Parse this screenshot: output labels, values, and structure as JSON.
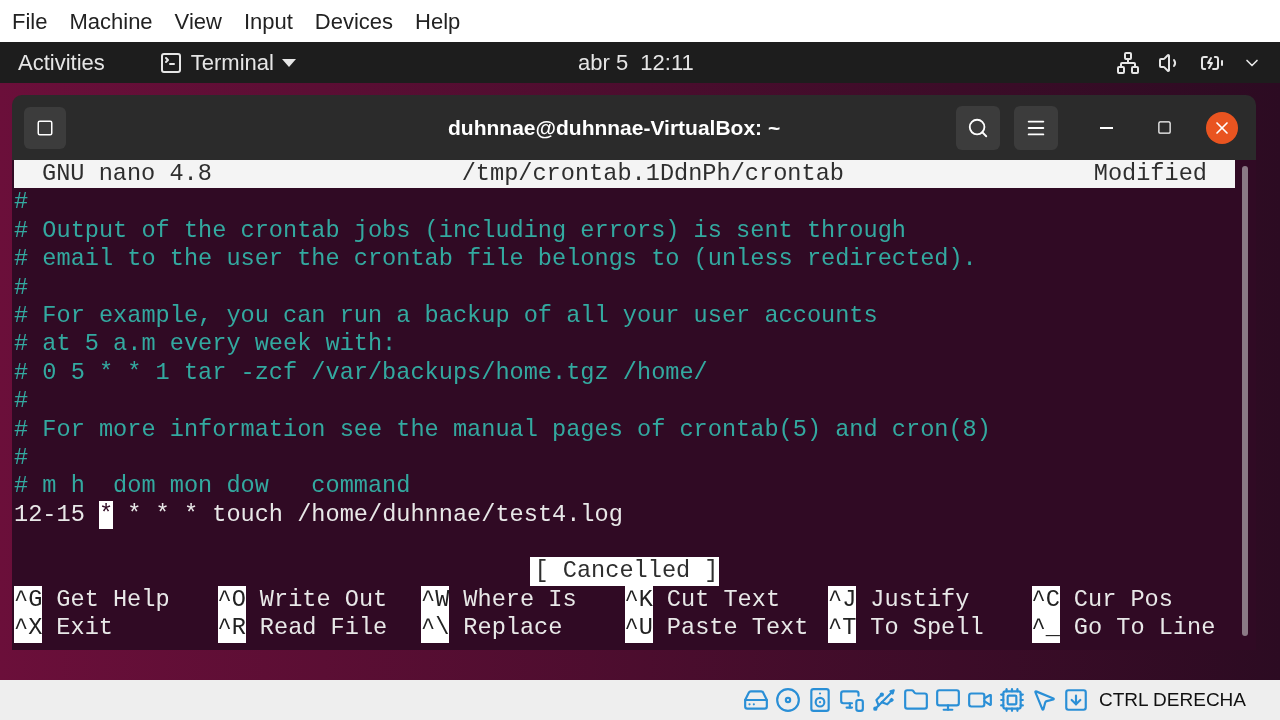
{
  "menu_bar": [
    "File",
    "Machine",
    "View",
    "Input",
    "Devices",
    "Help"
  ],
  "top_bar": {
    "activities": "Activities",
    "app": "Terminal",
    "clock": "abr 5  12:11"
  },
  "window": {
    "title": "duhnnae@duhnnae-VirtualBox: ~"
  },
  "nano": {
    "header": {
      "version": "GNU nano 4.8",
      "file": "/tmp/crontab.1DdnPh/crontab",
      "state": "Modified"
    },
    "lines": [
      {
        "kind": "comment",
        "text": "#"
      },
      {
        "kind": "comment",
        "text": "# Output of the crontab jobs (including errors) is sent through"
      },
      {
        "kind": "comment",
        "text": "# email to the user the crontab file belongs to (unless redirected)."
      },
      {
        "kind": "comment",
        "text": "#"
      },
      {
        "kind": "comment",
        "text": "# For example, you can run a backup of all your user accounts"
      },
      {
        "kind": "comment",
        "text": "# at 5 a.m every week with:"
      },
      {
        "kind": "comment",
        "text": "# 0 5 * * 1 tar -zcf /var/backups/home.tgz /home/"
      },
      {
        "kind": "comment",
        "text": "#"
      },
      {
        "kind": "comment",
        "text": "# For more information see the manual pages of crontab(5) and cron(8)"
      },
      {
        "kind": "comment",
        "text": "#"
      },
      {
        "kind": "comment",
        "text": "# m h  dom mon dow   command"
      },
      {
        "kind": "code",
        "before": "12-15 ",
        "cursor": "*",
        "after": " * * * touch /home/duhnnae/test4.log"
      }
    ],
    "message": "[ Cancelled ]",
    "shortcuts": [
      [
        {
          "key": "^G",
          "label": "Get Help"
        },
        {
          "key": "^O",
          "label": "Write Out"
        },
        {
          "key": "^W",
          "label": "Where Is"
        },
        {
          "key": "^K",
          "label": "Cut Text"
        },
        {
          "key": "^J",
          "label": "Justify"
        },
        {
          "key": "^C",
          "label": "Cur Pos"
        }
      ],
      [
        {
          "key": "^X",
          "label": "Exit"
        },
        {
          "key": "^R",
          "label": "Read File"
        },
        {
          "key": "^\\",
          "label": "Replace"
        },
        {
          "key": "^U",
          "label": "Paste Text"
        },
        {
          "key": "^T",
          "label": "To Spell"
        },
        {
          "key": "^_",
          "label": "Go To Line"
        }
      ]
    ]
  },
  "status_bar": {
    "host_key": "CTRL DERECHA"
  }
}
